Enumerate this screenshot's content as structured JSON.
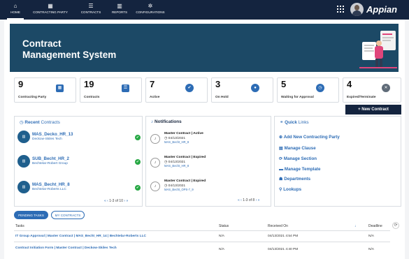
{
  "nav": [
    {
      "label": "HOME",
      "icon": "house-icon",
      "glyph": "⌂"
    },
    {
      "label": "CONTRACTING PARTY",
      "icon": "grid-icon",
      "glyph": "▦"
    },
    {
      "label": "CONTRACTS",
      "icon": "list-icon",
      "glyph": "☰"
    },
    {
      "label": "REPORTS",
      "icon": "bar-chart-icon",
      "glyph": "▥"
    },
    {
      "label": "CONFIGURATIONS",
      "icon": "gear-icon",
      "glyph": "✲"
    }
  ],
  "brand": "Appian",
  "hero": {
    "title": "Contract\nManagement System"
  },
  "stats": [
    {
      "value": "9",
      "label": "Contracting Party",
      "icon": "grid-icon",
      "glyph": "▦"
    },
    {
      "value": "19",
      "label": "Contracts",
      "icon": "list-icon",
      "glyph": "☰"
    },
    {
      "value": "7",
      "label": "Active",
      "icon": "check-circle-icon",
      "glyph": "✔"
    },
    {
      "value": "3",
      "label": "On Hold",
      "icon": "pause-circle-icon",
      "glyph": "●"
    },
    {
      "value": "5",
      "label": "Waiting for Approval",
      "icon": "clock-icon",
      "glyph": "◷"
    },
    {
      "value": "4",
      "label": "Expired/Terminate",
      "icon": "times-circle-icon",
      "glyph": "✕"
    }
  ],
  "new_contract_label": "+ New Contract",
  "recent": {
    "title_strong": "Recent",
    "title_rest": " Contracts",
    "items": [
      {
        "name": "MAS_Decko_HR_13",
        "company": "Deckow-Skiles Tech"
      },
      {
        "name": "SUB_Becht_HR_2",
        "company": "Bechtelar-Robert Group"
      },
      {
        "name": "MAS_Becht_HR_8",
        "company": "Bechtelar-Roberts LLC"
      }
    ],
    "pager": "1-3 of 10"
  },
  "notifications": {
    "title": "Notifications",
    "items": [
      {
        "title": "Master Contract | Active",
        "date": "04/13/2021",
        "code": "MAS_Becht_HR_8"
      },
      {
        "title": "Master Contract | Expired",
        "date": "04/13/2021",
        "code": "MAS_Becht_HR_8"
      },
      {
        "title": "Master Contract | Expired",
        "date": "04/13/2021",
        "code": "MAS_Becht_OPS-7_9"
      }
    ],
    "pager": "1-3 of 8"
  },
  "quick_links": {
    "title_strong": "Quick",
    "title_rest": " Links",
    "items": [
      {
        "label": "Add New Contracting Party",
        "icon": "plus-circle-icon",
        "glyph": "⊕"
      },
      {
        "label": "Manage Clause",
        "icon": "document-icon",
        "glyph": "▤"
      },
      {
        "label": "Manage Section",
        "icon": "refresh-icon",
        "glyph": "⟳"
      },
      {
        "label": "Manage Template",
        "icon": "folder-icon",
        "glyph": "▬"
      },
      {
        "label": "Departments",
        "icon": "users-icon",
        "glyph": "☗"
      },
      {
        "label": "Lookups",
        "icon": "search-icon",
        "glyph": "⚲"
      }
    ]
  },
  "tasks": {
    "tabs": [
      "PENDING TASKS",
      "MY CONTRACTS"
    ],
    "headers": {
      "task": "Tasks",
      "status": "Status",
      "received": "Received On",
      "deadline": "Deadline"
    },
    "rows": [
      {
        "task": "IT Group Approval | Master Contract | MAS_Becht_HR_14 | Bechtelar-Roberts LLC",
        "status": "N/A",
        "received": "04/13/2021 4:54 PM",
        "deadline": "N/A"
      },
      {
        "task": "Contract Initiation Form | Master Contract | Deckow-Skiles Tech",
        "status": "N/A",
        "received": "04/13/2021 4:40 PM",
        "deadline": "N/A"
      }
    ]
  },
  "colors": {
    "nav": "#14243f",
    "hero": "#1c4966",
    "accent": "#2d6cb5",
    "success": "#27a844"
  }
}
